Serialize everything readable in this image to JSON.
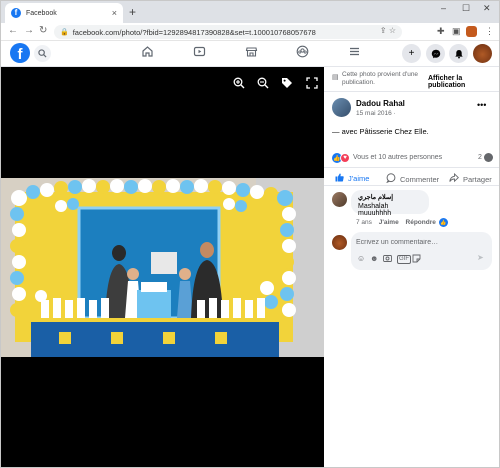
{
  "browser": {
    "tab_title": "Facebook",
    "tab_close": "×",
    "new_tab": "+",
    "win_min": "–",
    "win_max": "☐",
    "win_close": "✕",
    "url": "facebook.com/photo/?fbid=1292894817390828&set=t.100010768057678",
    "icons": [
      "back-arrow",
      "forward-arrow",
      "reload",
      "lock",
      "share",
      "star",
      "extension-puzzle",
      "split-view",
      "profile",
      "menu-kebab"
    ]
  },
  "facebook_nav": {
    "logo": "f",
    "icons": [
      "search",
      "home",
      "video",
      "marketplace",
      "groups",
      "menu",
      "create-plus",
      "messenger",
      "notifications-bell",
      "profile"
    ]
  },
  "viewer": {
    "tools": [
      "zoom-in",
      "zoom-out",
      "tag"
    ],
    "photo_colors": {
      "backdrop": "#1c7fbf",
      "wall_yellow": "#f2d33a",
      "balloon_white": "#ffffff",
      "balloon_blue": "#6ec3f0",
      "table": "#1a5fa6"
    }
  },
  "post": {
    "origin_text": "Cette photo provient d'une publication.",
    "view_publication": "Afficher la publication",
    "author": "Dadou Rahal",
    "date": "15 mai 2016 ·",
    "with_text": "— avec Pâtisserie Chez Elle.",
    "reactions_text": "Vous et 10 autres personnes",
    "comment_count": "2",
    "actions": {
      "like": "J'aime",
      "comment": "Commenter",
      "share": "Partager"
    }
  },
  "comment": {
    "author": "إسلام ماجري",
    "text": "Mashalah muuuhhhh",
    "age": "7 ans",
    "like": "J'aime",
    "reply": "Répondre"
  },
  "composer": {
    "placeholder": "Écrivez un commentaire…"
  },
  "colors": {
    "fb_blue": "#1877f2",
    "text_secondary": "#65676b",
    "bubble_bg": "#f0f2f5"
  }
}
